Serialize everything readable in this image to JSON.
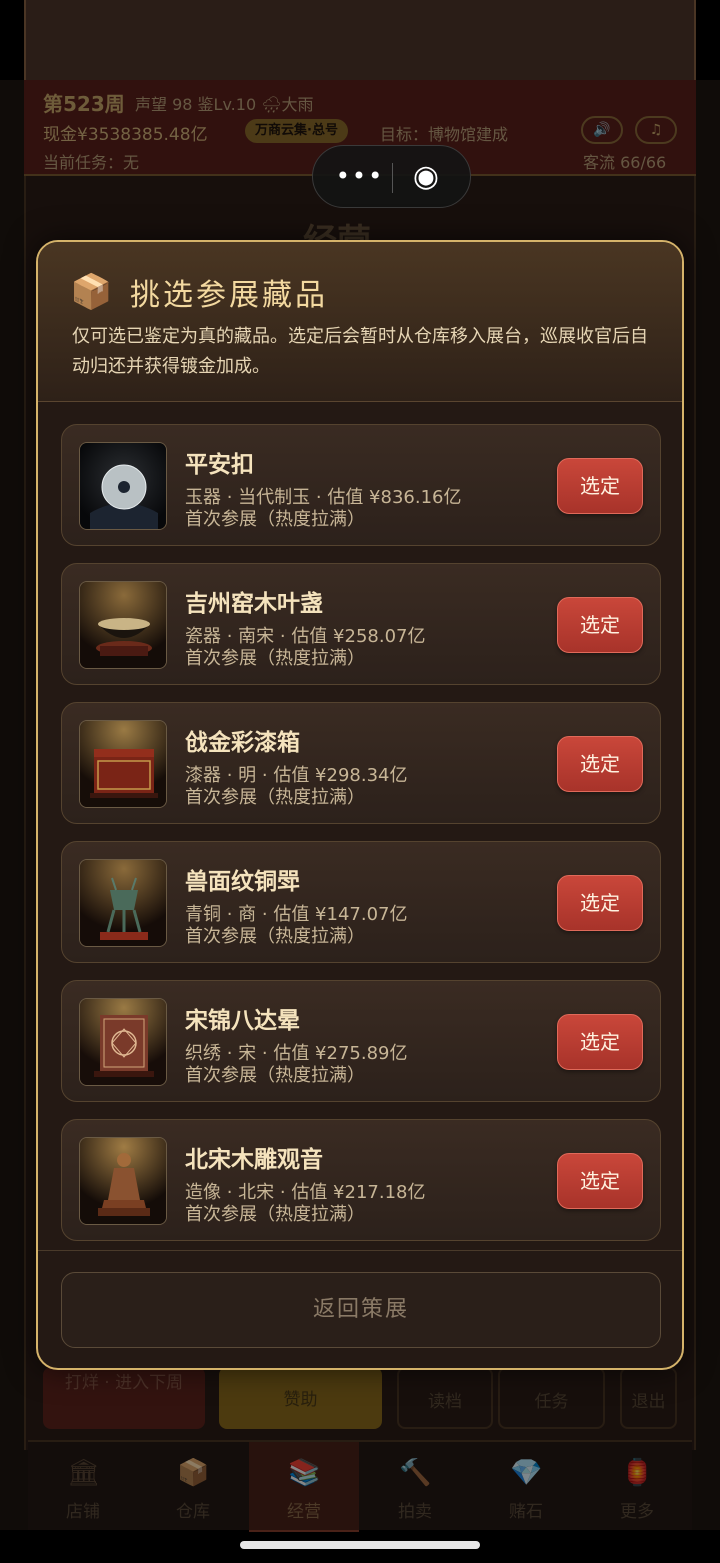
{
  "hud": {
    "week": "第523周",
    "stats": "声望 98  鉴Lv.10 🌧大雨",
    "cash": "现金¥3538385.48亿",
    "badge": "万商云集·总号",
    "goal": "目标：博物馆建成",
    "task": "当前任务：无",
    "traffic": "客流 66/66",
    "sound_icon": "🔊",
    "music_icon": "♫"
  },
  "section_title": "经营",
  "capsule": {
    "more_icon": "•••",
    "target_icon": "◉"
  },
  "modal": {
    "icon": "📦",
    "title": "挑选参展藏品",
    "description": "仅可选已鉴定为真的藏品。选定后会暂时从仓库移入展台，巡展收官后自动归还并获得镀金加成。",
    "items": [
      {
        "name": "平安扣",
        "meta": "玉器 · 当代制玉 · 估值 ¥836.16亿",
        "note": "首次参展（热度拉满）",
        "action": "选定"
      },
      {
        "name": "吉州窑木叶盏",
        "meta": "瓷器 · 南宋 · 估值 ¥258.07亿",
        "note": "首次参展（热度拉满）",
        "action": "选定"
      },
      {
        "name": "戗金彩漆箱",
        "meta": "漆器 · 明 · 估值 ¥298.34亿",
        "note": "首次参展（热度拉满）",
        "action": "选定"
      },
      {
        "name": "兽面纹铜斝",
        "meta": "青铜 · 商 · 估值 ¥147.07亿",
        "note": "首次参展（热度拉满）",
        "action": "选定"
      },
      {
        "name": "宋锦八达晕",
        "meta": "织绣 · 宋 · 估值 ¥275.89亿",
        "note": "首次参展（热度拉满）",
        "action": "选定"
      },
      {
        "name": "北宋木雕观音",
        "meta": "造像 · 北宋 · 估值 ¥217.18亿",
        "note": "首次参展（热度拉满）",
        "action": "选定"
      }
    ],
    "back_label": "返回策展"
  },
  "actions": {
    "advance": "打烊 · 进入下周",
    "sponsor": "赞助",
    "save": "读档",
    "task": "任务",
    "exit": "退出"
  },
  "tabs": [
    {
      "label": "店铺",
      "icon": "🏛"
    },
    {
      "label": "仓库",
      "icon": "📦"
    },
    {
      "label": "经营",
      "icon": "📚"
    },
    {
      "label": "拍卖",
      "icon": "🔨"
    },
    {
      "label": "赌石",
      "icon": "💎"
    },
    {
      "label": "更多",
      "icon": "🏮"
    }
  ]
}
